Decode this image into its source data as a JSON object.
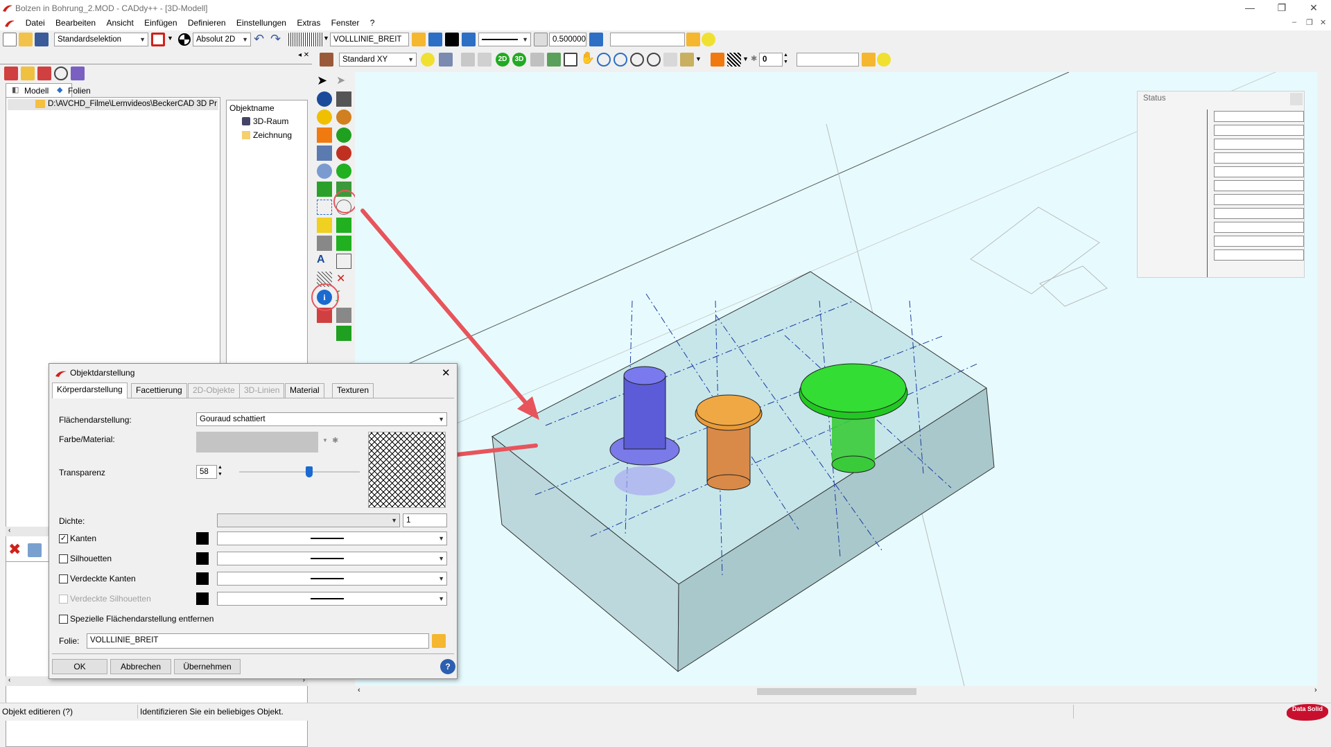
{
  "app": {
    "title": "Bolzen in Bohrung_2.MOD  -  CADdy++ - [3D-Modell]",
    "window_controls": {
      "minimize": "—",
      "restore": "❐",
      "close": "✕"
    },
    "mdi_controls": {
      "minimize": "–",
      "restore": "❐",
      "close": "✕"
    }
  },
  "menu": [
    "Datei",
    "Bearbeiten",
    "Ansicht",
    "Einfügen",
    "Definieren",
    "Einstellungen",
    "Extras",
    "Fenster",
    "?"
  ],
  "toolbar1": {
    "selection_mode": "Standardselektion",
    "coord_mode": "Absolut 2D",
    "layer": "VOLLLINIE_BREIT",
    "line_width": "0.500000",
    "empty_field": ""
  },
  "toolbar2": {
    "view": "Standard XY",
    "counter": "0",
    "empty_field": "",
    "btn_2d": "2D",
    "btn_3d": "3D"
  },
  "left_panel": {
    "tab_model": "Modell",
    "tab_layers": "Folien",
    "tree_path": "D:\\AVCHD_Filme\\Lernvideos\\BeckerCAD 3D Pr",
    "object_header": "Objektname",
    "objects": [
      "3D-Raum",
      "Zeichnung"
    ]
  },
  "status_window": {
    "title": "Status",
    "rows": 11
  },
  "dialog": {
    "title": "Objektdarstellung",
    "tabs": [
      {
        "label": "Körperdarstellung",
        "state": "active"
      },
      {
        "label": "Facettierung",
        "state": "normal"
      },
      {
        "label": "2D-Objekte",
        "state": "disabled"
      },
      {
        "label": "3D-Linien",
        "state": "disabled"
      },
      {
        "label": "Material",
        "state": "normal"
      },
      {
        "label": "Texturen",
        "state": "normal"
      }
    ],
    "surface_label": "Flächendarstellung:",
    "surface_value": "Gouraud schattiert",
    "material_label": "Farbe/Material:",
    "transparency_label": "Transparenz",
    "transparency_value": "58",
    "transparency_fraction": 0.58,
    "density_label": "Dichte:",
    "density_value": "1",
    "edges_label": "Kanten",
    "silhouettes_label": "Silhouetten",
    "hidden_edges_label": "Verdeckte Kanten",
    "hidden_silhouettes_label": "Verdeckte Silhouetten",
    "remove_special_label": "Spezielle Flächendarstellung entfernen",
    "layer_label": "Folie:",
    "layer_value": "VOLLLINIE_BREIT",
    "ok": "OK",
    "cancel": "Abbrechen",
    "apply": "Übernehmen",
    "help": "?"
  },
  "statusbar": {
    "left": "Objekt editieren (?)",
    "message": "Identifizieren Sie ein beliebiges Objekt.",
    "logo": "Data Solid"
  },
  "colors": {
    "viewport_bg": "#e7fbff",
    "annotation_red": "#e8545b",
    "block_face": "#b8d5d8",
    "pin_blue": "#6666dd",
    "pin_orange": "#e08a3a",
    "pin_green": "#2fd12f"
  }
}
